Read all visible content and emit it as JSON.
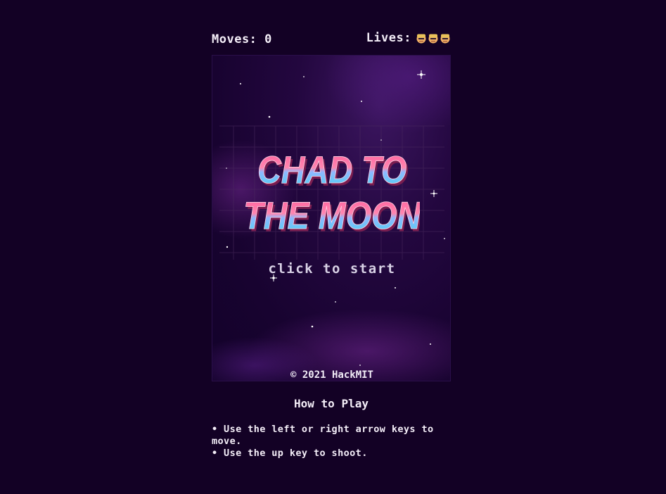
{
  "hud": {
    "moves_label": "Moves:",
    "moves_value": "0",
    "lives_label": "Lives:",
    "lives_count": 3,
    "life_icon": "chad-face-icon"
  },
  "game": {
    "title_line1": "CHAD TO",
    "title_line2": "THE MOON",
    "prompt": "click to start",
    "copyright": "© 2021 HackMIT"
  },
  "instructions": {
    "heading": "How to Play",
    "rules": [
      "• Use the left or right arrow keys to move.",
      "• Use the up key to shoot."
    ]
  },
  "colors": {
    "background": "#130125",
    "title_gradient_top": "#ff5a9a",
    "title_gradient_bottom": "#3ed8f2",
    "title_shadow": "#7a1d4f"
  }
}
